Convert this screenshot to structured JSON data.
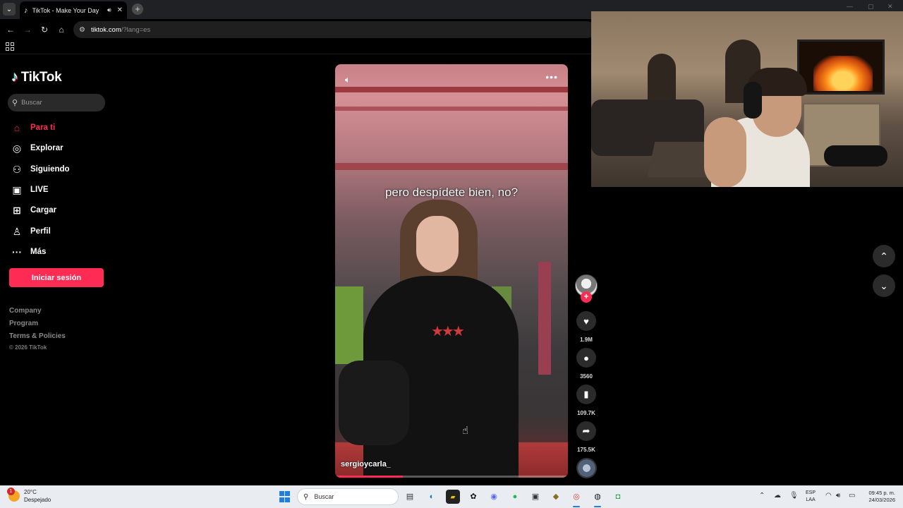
{
  "browser": {
    "tab_title": "TikTok - Make Your Day",
    "url_host": "tiktok.com",
    "url_path": "/?lang=es"
  },
  "tiktok": {
    "logo": "TikTok",
    "search_placeholder": "Buscar",
    "menu": [
      {
        "label": "Para ti",
        "icon": "home-icon",
        "active": true
      },
      {
        "label": "Explorar",
        "icon": "compass-icon"
      },
      {
        "label": "Siguiendo",
        "icon": "following-icon"
      },
      {
        "label": "LIVE",
        "icon": "live-icon"
      },
      {
        "label": "Cargar",
        "icon": "upload-icon"
      },
      {
        "label": "Perfil",
        "icon": "profile-icon"
      },
      {
        "label": "Más",
        "icon": "more-icon"
      }
    ],
    "login_button": "Iniciar sesión",
    "footer_links": [
      "Company",
      "Program",
      "Terms & Policies"
    ],
    "copyright": "© 2026 TikTok",
    "accent": "#fe2c55"
  },
  "video": {
    "caption": "pero despídete bien, no?",
    "author": "sergioycarla_",
    "progress": 0.29,
    "actions": {
      "likes": "1.9M",
      "comments": "3560",
      "saves": "109.7K",
      "shares": "175.5K"
    }
  },
  "taskbar": {
    "weather_temp": "20°C",
    "weather_desc": "Despejado",
    "weather_badge": "1",
    "search_placeholder": "Buscar",
    "lang_top": "ESP",
    "lang_bottom": "LAA",
    "time": "09:45 p. m.",
    "date": "24/03/2026"
  }
}
